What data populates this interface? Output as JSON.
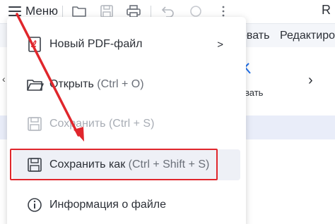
{
  "toolbar": {
    "menu_label": "Меню",
    "app_fragment": "R"
  },
  "ribbon": {
    "tab_partial_1": "овать",
    "tab_partial_2": "Редактиро",
    "sub_label_partial": "вать"
  },
  "dropdown": {
    "items": [
      {
        "label": "Новый PDF-файл",
        "shortcut": "",
        "arrow": ">",
        "icon": "new-pdf-icon",
        "disabled": false
      },
      {
        "label": "Открыть",
        "shortcut": "(Ctrl + O)",
        "icon": "folder-open-icon",
        "disabled": false
      },
      {
        "label": "Сохранить",
        "shortcut": "(Ctrl + S)",
        "icon": "save-icon",
        "disabled": true
      },
      {
        "label": "Сохранить как",
        "shortcut": "(Ctrl + Shift + S)",
        "icon": "save-as-icon",
        "disabled": false,
        "highlighted": true
      },
      {
        "label": "Информация о файле",
        "shortcut": "",
        "icon": "info-icon",
        "disabled": false
      }
    ]
  },
  "annotation": {
    "color": "#e0262c"
  }
}
